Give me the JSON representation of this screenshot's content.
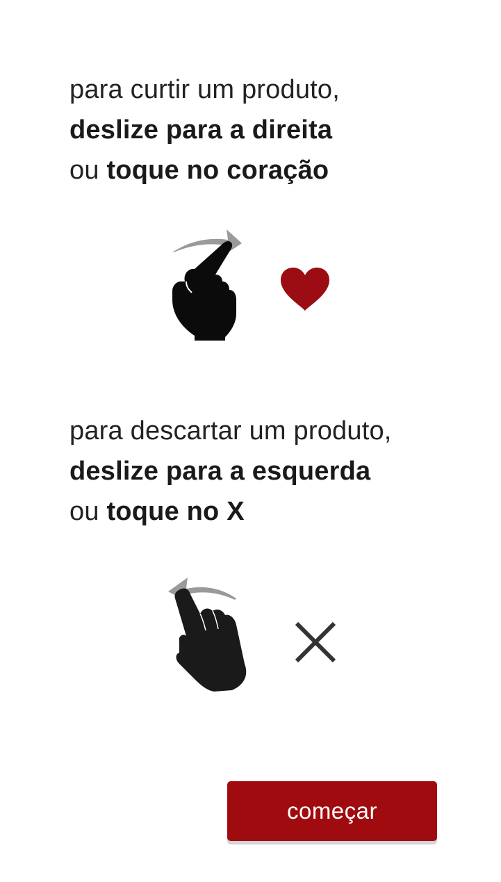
{
  "like_instruction": {
    "line1": "para curtir um produto,",
    "line2": "deslize para a direita",
    "line3_prefix": "ou ",
    "line3_bold": "toque no coração"
  },
  "dislike_instruction": {
    "line1": "para descartar um produto,",
    "line2": "deslize para a esquerda",
    "line3_prefix": "ou ",
    "line3_bold": "toque no X"
  },
  "icons": {
    "swipe_right": "swipe-right-hand-icon",
    "heart": "heart-icon",
    "swipe_left": "swipe-left-hand-icon",
    "close": "x-icon"
  },
  "colors": {
    "accent": "#a00b10",
    "heart": "#9b0d12",
    "arrow": "#9a9a9a",
    "hand": "#0b0b0b",
    "x": "#333333"
  },
  "start_button": {
    "label": "começar"
  }
}
